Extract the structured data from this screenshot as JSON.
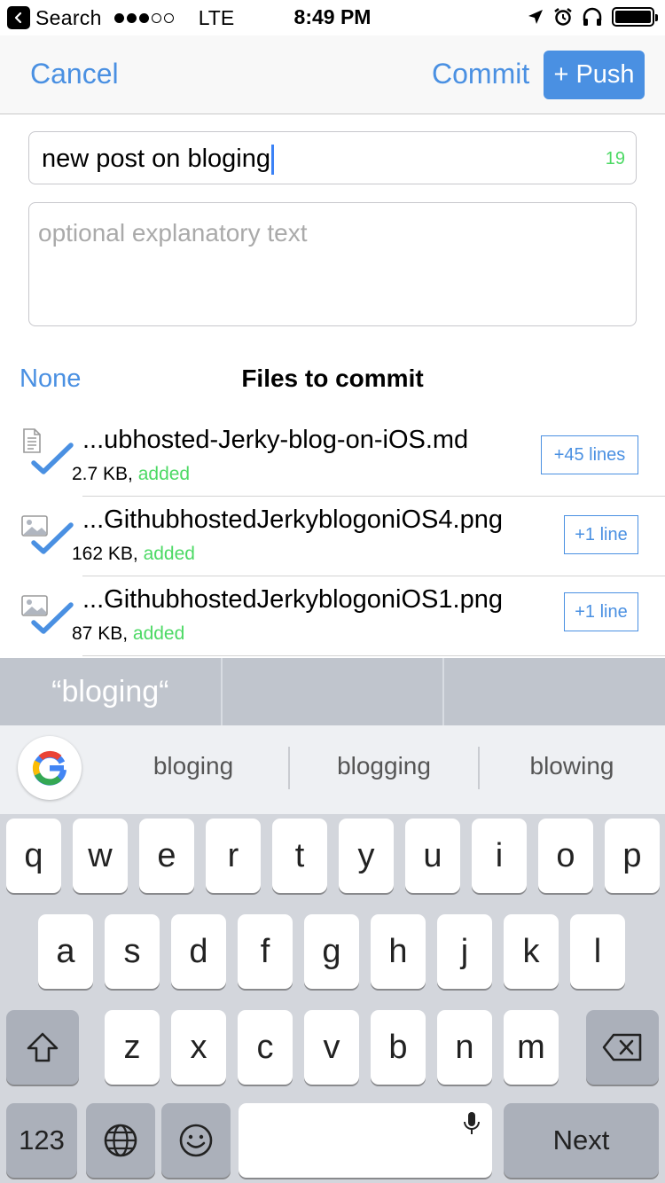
{
  "status_bar": {
    "back_label": "Search",
    "carrier": "LTE",
    "time": "8:49 PM"
  },
  "nav": {
    "cancel": "Cancel",
    "commit": "Commit",
    "push": "+ Push"
  },
  "commit_message": {
    "value": "new post on bloging",
    "count": "19"
  },
  "description": {
    "placeholder": "optional explanatory text"
  },
  "files_header": {
    "none": "None",
    "title": "Files to commit"
  },
  "files": [
    {
      "name": "...ubhosted-Jerky-blog-on-iOS.md",
      "size": "2.7 KB",
      "status": "added",
      "lines": "+45 lines",
      "icon": "document-icon"
    },
    {
      "name": "...GithubhostedJerkyblogoniOS4.png",
      "size": "162 KB",
      "status": "added",
      "lines": "+1 line",
      "icon": "image-icon"
    },
    {
      "name": "...GithubhostedJerkyblogoniOS1.png",
      "size": "87 KB",
      "status": "added",
      "lines": "+1 line",
      "icon": "image-icon"
    }
  ],
  "autocorrect": [
    "“bloging“",
    "",
    ""
  ],
  "suggestions": [
    "bloging",
    "blogging",
    "blowing"
  ],
  "keyboard": {
    "row1": [
      "q",
      "w",
      "e",
      "r",
      "t",
      "y",
      "u",
      "i",
      "o",
      "p"
    ],
    "row2": [
      "a",
      "s",
      "d",
      "f",
      "g",
      "h",
      "j",
      "k",
      "l"
    ],
    "row3": [
      "z",
      "x",
      "c",
      "v",
      "b",
      "n",
      "m"
    ],
    "numbers": "123",
    "next": "Next"
  },
  "colors": {
    "accent": "#4a90e2",
    "added": "#4cd964"
  }
}
